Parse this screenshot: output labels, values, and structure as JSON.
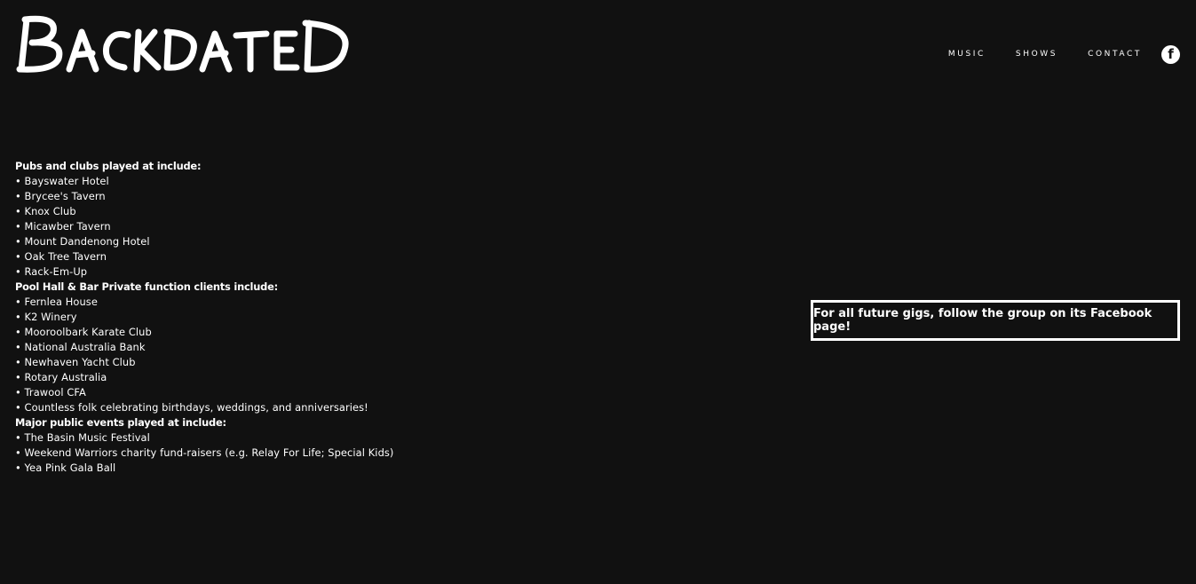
{
  "header": {
    "logo_text": "BACKDATED",
    "nav": [
      {
        "label": "MUSIC"
      },
      {
        "label": "SHOWS"
      },
      {
        "label": "CONTACT"
      }
    ],
    "social_icon": "facebook-icon",
    "social_glyph": "f"
  },
  "content": {
    "sections": [
      {
        "heading": "Pubs and clubs played at include:",
        "items": [
          "• Bayswater Hotel",
          "• Brycee's Tavern",
          "• Knox Club",
          "• Micawber Tavern",
          "• Mount Dandenong Hotel",
          "• Oak Tree Tavern",
          "• Rack-Em-Up"
        ]
      },
      {
        "heading": "Pool Hall & Bar Private function clients include:",
        "items": [
          "• Fernlea House",
          "• K2 Winery",
          "• Mooroolbark Karate Club",
          "• National Australia Bank",
          "• Newhaven Yacht Club",
          "• Rotary Australia",
          "• Trawool CFA",
          "• Countless folk celebrating birthdays, weddings, and anniversaries!"
        ]
      },
      {
        "heading": "Major public events played at include:",
        "items": [
          "• The Basin Music Festival",
          "• Weekend Warriors charity fund-raisers (e.g. Relay For Life; Special Kids)",
          "• Yea Pink Gala Ball"
        ]
      }
    ]
  },
  "callout": {
    "text": "For all future gigs, follow the group on its Facebook page!"
  },
  "colors": {
    "background": "#111111",
    "text": "#ffffff"
  }
}
